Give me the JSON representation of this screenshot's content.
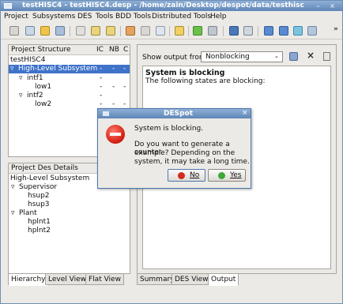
{
  "window": {
    "title": "testHISC4 - testHISC4.desp - /home/zain/Desktop/despot/data/testhisc",
    "minimize": "–",
    "close": "×"
  },
  "menu": [
    "Project",
    "Subsystems",
    "DES",
    "Tools",
    "BDD Tools",
    "Distributed Tools",
    "Help"
  ],
  "toolbar": {
    "more": "»",
    "icons": [
      "new-project-icon",
      "open-project-icon",
      "edit-icon",
      "view-icon",
      "des-add-icon",
      "des-remove-icon",
      "subsystem-icon",
      "edit-des-icon",
      "properties-icon",
      "bdd-icon",
      "check-icon",
      "eye-icon",
      "wrench-icon",
      "print-icon",
      "chart-icon",
      "chart2-icon",
      "flag-icon",
      "step-icon"
    ]
  },
  "project_structure": {
    "headers": [
      "Project Structure",
      "IC",
      "NB",
      "C"
    ],
    "rows": [
      {
        "label": "testHISC4",
        "ic": "",
        "nb": "",
        "c": ""
      },
      {
        "label": "High-Level Subsystem",
        "ic": "-",
        "nb": "-",
        "c": "-"
      },
      {
        "label": "intf1",
        "ic": "-",
        "nb": "",
        "c": ""
      },
      {
        "label": "low1",
        "ic": "-",
        "nb": "-",
        "c": "-"
      },
      {
        "label": "intf2",
        "ic": "-",
        "nb": "",
        "c": ""
      },
      {
        "label": "low2",
        "ic": "-",
        "nb": "-",
        "c": "-"
      }
    ]
  },
  "des_details": {
    "header": "Project Des Details",
    "rows": [
      "High-Level Subsystem",
      "Supervisor",
      "hsup2",
      "hsup3",
      "Plant",
      "hplnt1",
      "hplnt2"
    ]
  },
  "left_tabs": [
    "Hierarchy",
    "Level View",
    "Flat View"
  ],
  "output": {
    "show_label": "Show output from:",
    "combo_value": "Nonblocking",
    "heading": "System is blocking",
    "body": "The following states are blocking:"
  },
  "right_tabs": [
    "Summary",
    "DES View",
    "Output"
  ],
  "dialog": {
    "title": "DESpot",
    "message1": "System is blocking.",
    "message2_line1": "Do you want to generate a counter",
    "message2_line2": "example? Depending on the",
    "message2_line3": "system, it may take a long time.",
    "no": "No",
    "yes": "Yes",
    "close": "×"
  },
  "colors": {
    "selection": "#3f73c9",
    "title_bar": "#6b90c0",
    "no_dot": "#d42a1e",
    "yes_dot": "#3fa63a"
  }
}
